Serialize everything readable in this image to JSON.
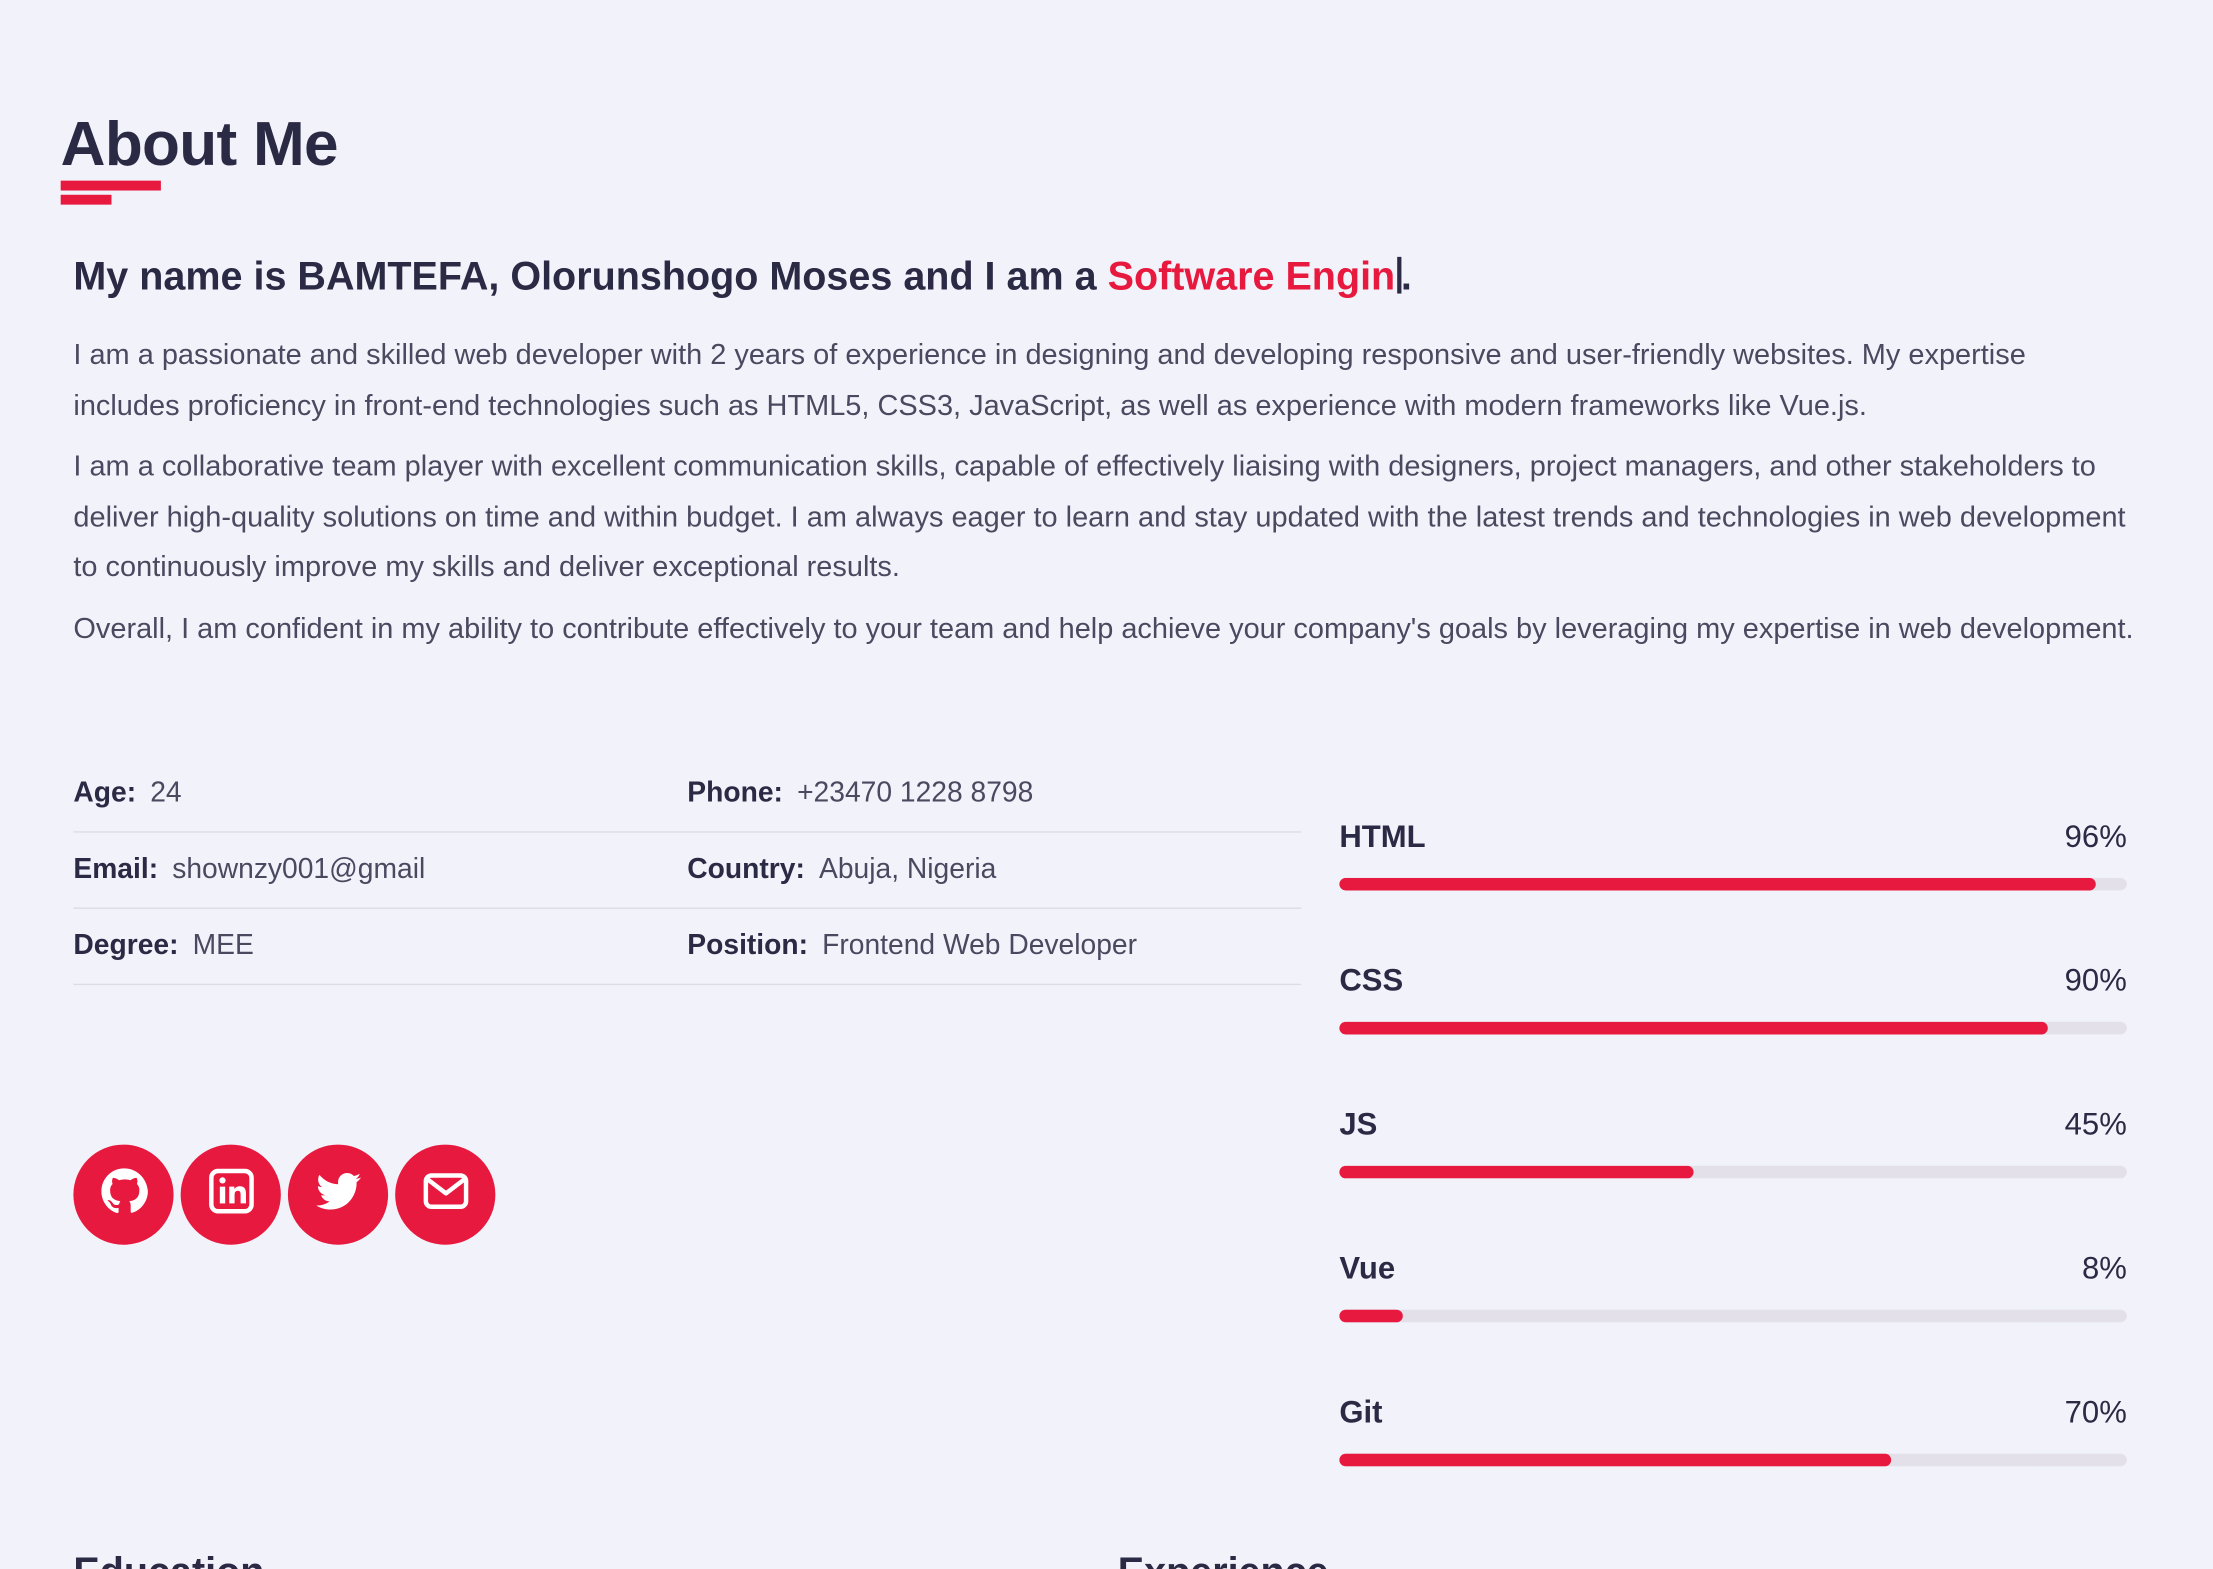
{
  "about": {
    "title": "About Me",
    "intro_prefix": "My name is BAMTEFA, Olorunshogo Moses and I am a ",
    "intro_role": "Software Engin",
    "intro_suffix": ".",
    "bio": [
      "I am a passionate and skilled web developer with 2 years of experience in designing and developing responsive and user-friendly websites. My expertise includes proficiency in front-end technologies such as HTML5, CSS3, JavaScript, as well as experience with modern frameworks like Vue.js.",
      "I am a collaborative team player with excellent communication skills, capable of effectively liaising with designers, project managers, and other stakeholders to deliver high-quality solutions on time and within budget. I am always eager to learn and stay updated with the latest trends and technologies in web development to continuously improve my skills and deliver exceptional results.",
      "Overall, I am confident in my ability to contribute effectively to your team and help achieve your company's goals by leveraging my expertise in web development."
    ]
  },
  "info": {
    "age_label": "Age:",
    "age": "24",
    "phone_label": "Phone:",
    "phone": "+23470 1228 8798",
    "email_label": "Email:",
    "email": "shownzy001@gmail",
    "country_label": "Country:",
    "country": "Abuja, Nigeria",
    "degree_label": "Degree:",
    "degree": "MEE",
    "position_label": "Position:",
    "position": "Frontend Web Developer"
  },
  "socials": {
    "accent": "#e8193f",
    "icons": [
      "github-icon",
      "linkedin-icon",
      "twitter-icon",
      "envelope-icon"
    ]
  },
  "skills": [
    {
      "name": "HTML",
      "label": "96%",
      "value": 96
    },
    {
      "name": "CSS",
      "label": "90%",
      "value": 90
    },
    {
      "name": "JS",
      "label": "45%",
      "value": 45
    },
    {
      "name": "Vue",
      "label": "8%",
      "value": 8
    },
    {
      "name": "Git",
      "label": "70%",
      "value": 70
    }
  ],
  "sections": {
    "education": "Education",
    "experience": "Experience"
  }
}
